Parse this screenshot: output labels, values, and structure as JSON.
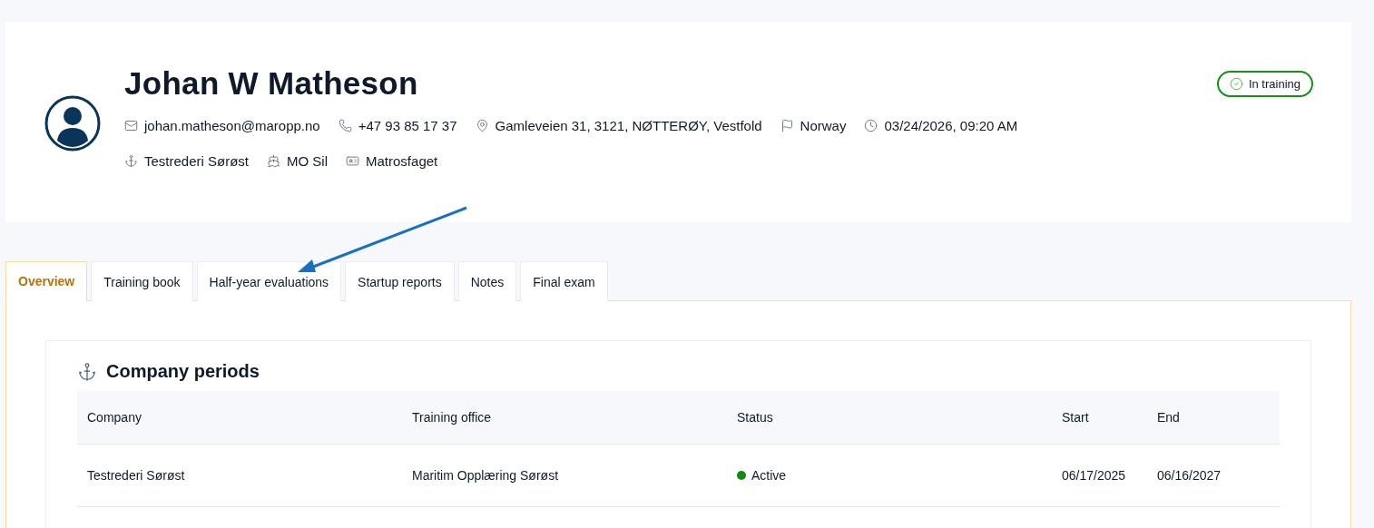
{
  "profile": {
    "name": "Johan W Matheson",
    "badge": "In training",
    "details": [
      {
        "kind": "email",
        "text": "johan.matheson@maropp.no"
      },
      {
        "kind": "phone",
        "text": "+47 93 85 17 37"
      },
      {
        "kind": "location",
        "text": "Gamleveien 31, 3121, NØTTERØY, Vestfold"
      },
      {
        "kind": "flag",
        "text": "Norway"
      },
      {
        "kind": "clock",
        "text": "03/24/2026, 09:20 AM"
      }
    ],
    "affiliations": [
      {
        "kind": "anchor",
        "text": "Testrederi Sørøst"
      },
      {
        "kind": "ship",
        "text": "MO Sil"
      },
      {
        "kind": "certificate",
        "text": "Matrosfaget"
      }
    ]
  },
  "tabs": [
    {
      "label": "Overview",
      "selected": true
    },
    {
      "label": "Training book",
      "selected": false
    },
    {
      "label": "Half-year evaluations",
      "selected": false
    },
    {
      "label": "Startup reports",
      "selected": false
    },
    {
      "label": "Notes",
      "selected": false
    },
    {
      "label": "Final exam",
      "selected": false
    }
  ],
  "company_periods": {
    "title": "Company periods",
    "columns": [
      "Company",
      "Training office",
      "Status",
      "Start",
      "End"
    ],
    "rows": [
      {
        "company": "Testrederi Sørøst",
        "training_office": "Maritim Opplæring Sørøst",
        "status": {
          "text": "Active",
          "color": "#108a10"
        },
        "start": "06/17/2025",
        "end": "06/16/2027"
      }
    ]
  }
}
